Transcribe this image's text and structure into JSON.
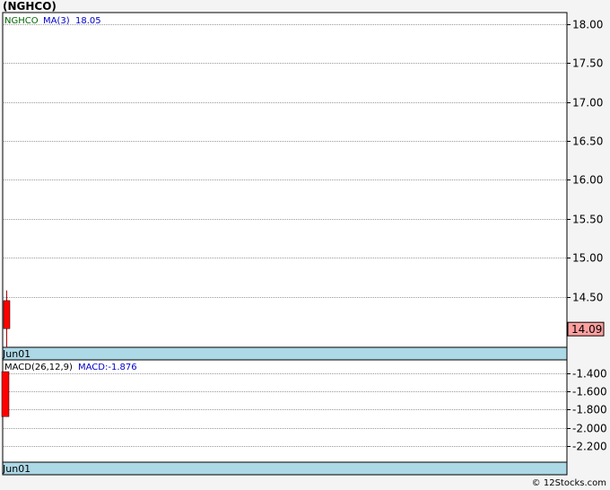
{
  "title": "(NGHCO)",
  "footer": "© 12Stocks.com",
  "colors": {
    "up": "#008000",
    "down": "#ff0000",
    "ma": "#0000cc",
    "symbol": "#006600",
    "date_strip": "#add8e6",
    "price_tag_bg": "#ffa0a0",
    "grid": "#999999"
  },
  "chart_data": [
    {
      "type": "candlestick",
      "panel": "price",
      "legend": {
        "symbol": "NGHCO",
        "ma_label": "MA(3)",
        "ma_value": "18.05"
      },
      "y_ticks": [
        "18.00",
        "17.50",
        "17.00",
        "16.50",
        "16.00",
        "15.50",
        "15.00",
        "14.50"
      ],
      "ylim": [
        13.85,
        18.15
      ],
      "last_price": "14.09",
      "x_labels": [
        "Jun01"
      ],
      "candles": [
        {
          "date": "Jun01",
          "open": 14.45,
          "close": 14.09,
          "high": 14.58,
          "low": 13.85
        }
      ],
      "grid": true
    },
    {
      "type": "bar",
      "panel": "macd",
      "legend": {
        "label": "MACD(26,12,9)",
        "macd_text": "MACD:-1.876"
      },
      "y_ticks": [
        "-1.400",
        "-1.600",
        "-1.800",
        "-2.000",
        "-2.200"
      ],
      "ylim": [
        -2.38,
        -1.25
      ],
      "x_labels": [
        "Jun01"
      ],
      "bars": [
        {
          "date": "Jun01",
          "top": -1.38,
          "bottom": -1.876
        }
      ],
      "grid": true
    }
  ]
}
